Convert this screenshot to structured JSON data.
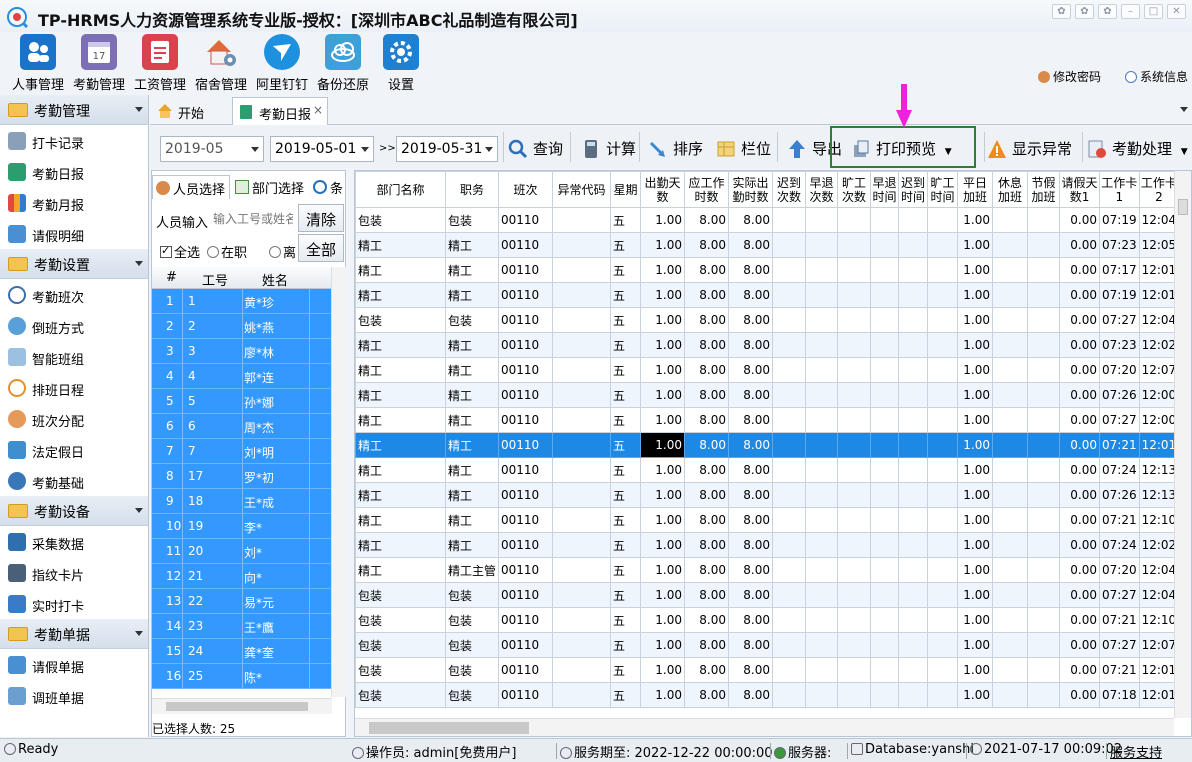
{
  "window": {
    "title": "TP-HRMS人力资源管理系统专业版-授权：[深圳市ABC礼品制造有限公司]"
  },
  "toolbar": [
    {
      "label": "人事管理",
      "icon": "people-icon",
      "color": "#1a73c9"
    },
    {
      "label": "考勤管理",
      "icon": "calendar-icon",
      "color": "#7d6fb5"
    },
    {
      "label": "工资管理",
      "icon": "payroll-icon",
      "color": "#d9434d"
    },
    {
      "label": "宿舍管理",
      "icon": "house-icon",
      "color": "#e06a3a"
    },
    {
      "label": "阿里钉钉",
      "icon": "dingtalk-icon",
      "color": "#1e90e0"
    },
    {
      "label": "备份还原",
      "icon": "cloud-icon",
      "color": "#3da0d8"
    },
    {
      "label": "设置",
      "icon": "gear-icon",
      "color": "#1f7fd1"
    }
  ],
  "top_links": {
    "change_password": "修改密码",
    "system_info": "系统信息"
  },
  "nav": {
    "groups": [
      {
        "title": "考勤管理",
        "items": [
          "打卡记录",
          "考勤日报",
          "考勤月报",
          "请假明细"
        ]
      },
      {
        "title": "考勤设置",
        "items": [
          "考勤班次",
          "倒班方式",
          "智能班组",
          "排班日程",
          "班次分配",
          "法定假日",
          "考勤基础"
        ]
      },
      {
        "title": "考勤设备",
        "items": [
          "采集数据",
          "指纹卡片",
          "实时打卡"
        ]
      },
      {
        "title": "考勤单据",
        "items": [
          "请假单据",
          "调班单据"
        ]
      }
    ]
  },
  "tabs": {
    "start": "开始",
    "daily": "考勤日报",
    "close": "×"
  },
  "filter": {
    "month": "2019-05",
    "start_date": "2019-05-01",
    "range_sep": ">>",
    "end_date": "2019-05-31",
    "buttons": {
      "query": "查询",
      "calc": "计算",
      "sort": "排序",
      "columns": "栏位",
      "export": "导出",
      "print_preview": "打印预览",
      "show_abnormal": "显示异常",
      "attendance_process": "考勤处理"
    }
  },
  "person_panel": {
    "tabs": {
      "person": "人员选择",
      "dept": "部门选择",
      "cond": "条"
    },
    "input_label": "人员输入",
    "input_placeholder": "输入工号或姓名",
    "clear": "清除",
    "all_button": "全部",
    "filters": {
      "select_all": "全选",
      "on_job": "在职",
      "left": "离"
    },
    "headers": {
      "idx": "#",
      "id": "工号",
      "name": "姓名"
    },
    "rows": [
      {
        "idx": "1",
        "id": "1",
        "name": "黄*珍"
      },
      {
        "idx": "2",
        "id": "2",
        "name": "姚*燕"
      },
      {
        "idx": "3",
        "id": "3",
        "name": "廖*林"
      },
      {
        "idx": "4",
        "id": "4",
        "name": "郭*连"
      },
      {
        "idx": "5",
        "id": "5",
        "name": "孙*娜"
      },
      {
        "idx": "6",
        "id": "6",
        "name": "周*杰"
      },
      {
        "idx": "7",
        "id": "7",
        "name": "刘*明"
      },
      {
        "idx": "8",
        "id": "17",
        "name": "罗*初"
      },
      {
        "idx": "9",
        "id": "18",
        "name": "王*成"
      },
      {
        "idx": "10",
        "id": "19",
        "name": "李*"
      },
      {
        "idx": "11",
        "id": "20",
        "name": "刘*"
      },
      {
        "idx": "12",
        "id": "21",
        "name": "向*"
      },
      {
        "idx": "13",
        "id": "22",
        "name": "易*元"
      },
      {
        "idx": "14",
        "id": "23",
        "name": "王*鷹"
      },
      {
        "idx": "15",
        "id": "24",
        "name": "龚*奎"
      },
      {
        "idx": "16",
        "id": "25",
        "name": "陈*"
      }
    ],
    "selected_count": "已选择人数: 25"
  },
  "grid": {
    "headers": [
      "部门名称",
      "职务",
      "班次",
      "异常代码",
      "星期",
      "出勤天数",
      "应工作时数",
      "实际出勤时数",
      "迟到次数",
      "早退次数",
      "旷工次数",
      "早退时间",
      "迟到时间",
      "旷工时间",
      "平日加班",
      "休息加班",
      "节假加班",
      "请假天数1",
      "工作卡1",
      "工作卡2"
    ],
    "rows": [
      [
        "包装",
        "包装",
        "00110",
        "",
        "五",
        "1.00",
        "8.00",
        "8.00",
        "",
        "",
        "",
        "",
        "",
        "",
        "1.00",
        "",
        "",
        "0.00",
        "07:19",
        "12:04"
      ],
      [
        "精工",
        "精工",
        "00110",
        "",
        "五",
        "1.00",
        "8.00",
        "8.00",
        "",
        "",
        "",
        "",
        "",
        "",
        "1.00",
        "",
        "",
        "0.00",
        "07:23",
        "12:05"
      ],
      [
        "精工",
        "精工",
        "00110",
        "",
        "五",
        "1.00",
        "8.00",
        "8.00",
        "",
        "",
        "",
        "",
        "",
        "",
        "1.00",
        "",
        "",
        "0.00",
        "07:17",
        "12:01"
      ],
      [
        "精工",
        "精工",
        "00110",
        "",
        "五",
        "1.00",
        "8.00",
        "8.00",
        "",
        "",
        "",
        "",
        "",
        "",
        "1.00",
        "",
        "",
        "0.00",
        "07:19",
        "12:01"
      ],
      [
        "包装",
        "包装",
        "00110",
        "",
        "五",
        "1.00",
        "8.00",
        "8.00",
        "",
        "",
        "",
        "",
        "",
        "",
        "1.00",
        "",
        "",
        "0.00",
        "07:27",
        "12:04"
      ],
      [
        "精工",
        "精工",
        "00110",
        "",
        "五",
        "1.00",
        "8.00",
        "8.00",
        "",
        "",
        "",
        "",
        "",
        "",
        "1.00",
        "",
        "",
        "0.00",
        "07:23",
        "12:02"
      ],
      [
        "精工",
        "精工",
        "00110",
        "",
        "五",
        "1.00",
        "8.00",
        "8.00",
        "",
        "",
        "",
        "",
        "",
        "",
        "1.00",
        "",
        "",
        "0.00",
        "07:20",
        "12:07"
      ],
      [
        "精工",
        "精工",
        "00110",
        "",
        "五",
        "1.00",
        "8.00",
        "8.00",
        "",
        "",
        "",
        "",
        "",
        "",
        "1.00",
        "",
        "",
        "0.00",
        "07:26",
        "12:00"
      ],
      [
        "精工",
        "精工",
        "00110",
        "",
        "五",
        "1.00",
        "8.00",
        "8.00",
        "",
        "",
        "",
        "",
        "",
        "",
        "1.00",
        "",
        "",
        "0.00",
        "07:27",
        "12:00"
      ],
      [
        "精工",
        "精工",
        "00110",
        "",
        "五",
        "1.00",
        "8.00",
        "8.00",
        "",
        "",
        "",
        "",
        "",
        "",
        "1.00",
        "",
        "",
        "0.00",
        "07:21",
        "12:01"
      ],
      [
        "精工",
        "精工",
        "00110",
        "",
        "五",
        "1.00",
        "8.00",
        "8.00",
        "",
        "",
        "",
        "",
        "",
        "",
        "1.00",
        "",
        "",
        "0.00",
        "07:24",
        "12:13"
      ],
      [
        "精工",
        "精工",
        "00110",
        "",
        "五",
        "1.00",
        "8.00",
        "8.00",
        "",
        "",
        "",
        "",
        "",
        "",
        "1.00",
        "",
        "",
        "0.00",
        "07:26",
        "12:13"
      ],
      [
        "精工",
        "精工",
        "00110",
        "",
        "五",
        "1.00",
        "8.00",
        "8.00",
        "",
        "",
        "",
        "",
        "",
        "",
        "1.00",
        "",
        "",
        "0.00",
        "07:21",
        "12:10"
      ],
      [
        "精工",
        "精工",
        "00110",
        "",
        "五",
        "1.00",
        "8.00",
        "8.00",
        "",
        "",
        "",
        "",
        "",
        "",
        "1.00",
        "",
        "",
        "0.00",
        "07:24",
        "12:02"
      ],
      [
        "精工",
        "精工主管",
        "00110",
        "",
        "五",
        "1.00",
        "8.00",
        "8.00",
        "",
        "",
        "",
        "",
        "",
        "",
        "1.00",
        "",
        "",
        "0.00",
        "07:20",
        "12:04"
      ],
      [
        "包装",
        "包装",
        "00110",
        "",
        "五",
        "1.00",
        "8.00",
        "8.00",
        "",
        "",
        "",
        "",
        "",
        "",
        "1.00",
        "",
        "",
        "0.00",
        "07:27",
        "12:04"
      ],
      [
        "包装",
        "包装",
        "00110",
        "",
        "五",
        "1.00",
        "8.00",
        "8.00",
        "",
        "",
        "",
        "",
        "",
        "",
        "1.00",
        "",
        "",
        "0.00",
        "07:21",
        "12:10"
      ],
      [
        "包装",
        "包装",
        "00110",
        "",
        "五",
        "1.00",
        "8.00",
        "8.00",
        "",
        "",
        "",
        "",
        "",
        "",
        "1.00",
        "",
        "",
        "0.00",
        "07:27",
        "12:07"
      ],
      [
        "包装",
        "包装",
        "00110",
        "",
        "五",
        "1.00",
        "8.00",
        "8.00",
        "",
        "",
        "",
        "",
        "",
        "",
        "1.00",
        "",
        "",
        "0.00",
        "07:21",
        "12:01"
      ],
      [
        "包装",
        "包装",
        "00110",
        "",
        "五",
        "1.00",
        "8.00",
        "8.00",
        "",
        "",
        "",
        "",
        "",
        "",
        "1.00",
        "",
        "",
        "0.00",
        "07:18",
        "12:01"
      ]
    ]
  },
  "status": {
    "ready": "Ready",
    "operator": "操作员: admin[免费用户]",
    "service_expiry": "服务期至: 2022-12-22 00:00:00",
    "server": "服务器:",
    "database": "Database:yanshi",
    "datetime": "2021-07-17 00:09:02",
    "support": "服务支持"
  },
  "colors": {
    "accent": "#3399ff",
    "selected_row": "#1e88e5",
    "highlight_box": "#2e7d32",
    "arrow": "#ee22dd"
  }
}
